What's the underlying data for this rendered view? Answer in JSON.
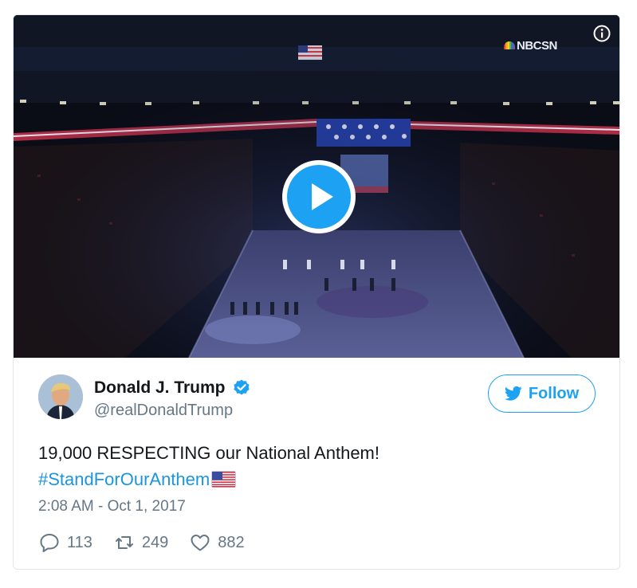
{
  "media": {
    "watermark": "NBCSN",
    "info_icon": "info-icon",
    "play_icon": "play-icon"
  },
  "author": {
    "display_name": "Donald J. Trump",
    "handle": "@realDonaldTrump",
    "verified": true
  },
  "follow": {
    "label": "Follow",
    "icon": "twitter-bird-icon"
  },
  "tweet": {
    "text": "19,000 RESPECTING our National Anthem!",
    "hashtag": "#StandForOurAnthem",
    "emoji": "us-flag-emoji",
    "timestamp": "2:08 AM - Oct 1, 2017"
  },
  "actions": {
    "replies": "113",
    "retweets": "249",
    "likes": "882"
  },
  "colors": {
    "accent": "#1da1f2",
    "link": "#1b95e0",
    "muted": "#657786",
    "text": "#14171a",
    "border": "#e1e8ed"
  }
}
